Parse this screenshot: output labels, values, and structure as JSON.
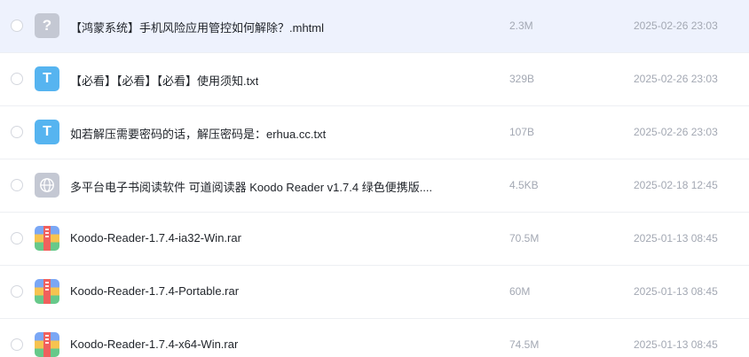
{
  "files": [
    {
      "name": "【鸿蒙系统】手机风险应用管控如何解除？.mhtml",
      "size": "2.3M",
      "date": "2025-02-26 23:03",
      "icon": "unknown-file-icon",
      "icon_glyph": "?",
      "selected": true
    },
    {
      "name": "【必看】【必看】【必看】使用须知.txt",
      "size": "329B",
      "date": "2025-02-26 23:03",
      "icon": "text-file-icon",
      "icon_glyph": "T",
      "selected": false
    },
    {
      "name": "如若解压需要密码的话，解压密码是：erhua.cc.txt",
      "size": "107B",
      "date": "2025-02-26 23:03",
      "icon": "text-file-icon",
      "icon_glyph": "T",
      "selected": false
    },
    {
      "name": "多平台电子书阅读软件 可道阅读器 Koodo Reader v1.7.4 绿色便携版....",
      "size": "4.5KB",
      "date": "2025-02-18 12:45",
      "icon": "web-file-icon",
      "icon_glyph": "",
      "selected": false
    },
    {
      "name": "Koodo-Reader-1.7.4-ia32-Win.rar",
      "size": "70.5M",
      "date": "2025-01-13 08:45",
      "icon": "archive-file-icon",
      "icon_glyph": "",
      "selected": false
    },
    {
      "name": "Koodo-Reader-1.7.4-Portable.rar",
      "size": "60M",
      "date": "2025-01-13 08:45",
      "icon": "archive-file-icon",
      "icon_glyph": "",
      "selected": false
    },
    {
      "name": "Koodo-Reader-1.7.4-x64-Win.rar",
      "size": "74.5M",
      "date": "2025-01-13 08:45",
      "icon": "archive-file-icon",
      "icon_glyph": "",
      "selected": false
    }
  ],
  "colors": {
    "selected_row": "#eef2fd",
    "text_icon": "#56b4f0",
    "unknown_icon": "#c4c8d3",
    "meta_text": "#a3a8b3"
  }
}
